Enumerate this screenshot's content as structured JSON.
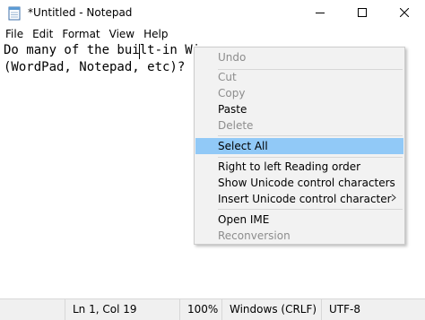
{
  "window": {
    "title": "*Untitled - Notepad"
  },
  "icons": {
    "app": "notepad-icon",
    "minimize": "minimize-icon",
    "maximize": "maximize-icon",
    "close": "close-icon",
    "submenu": "chevron-right-icon"
  },
  "menubar": {
    "items": [
      {
        "label": "File"
      },
      {
        "label": "Edit"
      },
      {
        "label": "Format"
      },
      {
        "label": "View"
      },
      {
        "label": "Help"
      }
    ]
  },
  "editor": {
    "line1": "Do many of the built-in Wi",
    "line2": "(WordPad, Notepad, etc)?"
  },
  "statusbar": {
    "position": "Ln 1, Col 19",
    "zoom": "100%",
    "line_ending": "Windows (CRLF)",
    "encoding": "UTF-8"
  },
  "context_menu": {
    "undo": "Undo",
    "cut": "Cut",
    "copy": "Copy",
    "paste": "Paste",
    "delete": "Delete",
    "select_all": "Select All",
    "rtl": "Right to left Reading order",
    "show_unicode": "Show Unicode control characters",
    "insert_unicode": "Insert Unicode control character",
    "open_ime": "Open IME",
    "reconversion": "Reconversion"
  },
  "colors": {
    "selection": "#91c9f7",
    "disabled_text": "#8d8d8d",
    "menu_background": "#f2f2f2",
    "statusbar_background": "#f0f0f0"
  }
}
